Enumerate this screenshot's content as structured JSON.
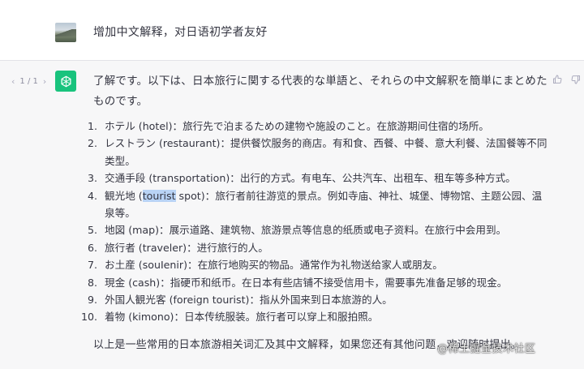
{
  "user_message": {
    "text": "增加中文解释，对日语初学者友好"
  },
  "assistant": {
    "pager": {
      "label": "1 / 1"
    },
    "intro": "了解です。以下は、日本旅行に関する代表的な単語と、それらの中文解釈を簡単にまとめたものです。",
    "items": [
      {
        "num": "1.",
        "text": "ホテル (hotel)：旅行先で泊まるための建物や施設のこと。在旅游期间住宿的场所。"
      },
      {
        "num": "2.",
        "text": "レストラン (restaurant)：提供餐饮服务的商店。有和食、西餐、中餐、意大利餐、法国餐等不同类型。"
      },
      {
        "num": "3.",
        "text": "交通手段 (transportation)：出行的方式。有电车、公共汽车、出租车、租车等多种方式。"
      },
      {
        "num": "4.",
        "pre": "観光地 (",
        "highlight": "tourist",
        "post": " spot)：旅行者前往游览的景点。例如寺庙、神社、城堡、博物馆、主题公园、温泉等。"
      },
      {
        "num": "5.",
        "text": "地図 (map)：展示道路、建筑物、旅游景点等信息的纸质或电子资料。在旅行中会用到。"
      },
      {
        "num": "6.",
        "text": "旅行者 (traveler)：进行旅行的人。"
      },
      {
        "num": "7.",
        "pre": "お土産 (sou",
        "caret": "I",
        "post": "enir)：在旅行地购买的物品。通常作为礼物送给家人或朋友。"
      },
      {
        "num": "8.",
        "text": "現金 (cash)：指硬币和纸币。在日本有些店铺不接受信用卡，需要事先准备足够的现金。"
      },
      {
        "num": "9.",
        "text": "外国人観光客 (foreign tourist)：指从外国来到日本旅游的人。"
      },
      {
        "num": "10.",
        "text": "着物 (kimono)：日本传统服装。旅行者可以穿上和服拍照。"
      }
    ],
    "summary": "以上是一些常用的日本旅游相关词汇及其中文解释，如果您还有其他问题，欢迎随时提出。"
  },
  "watermark": "@稀土掘金技术社区",
  "colors": {
    "assistant_avatar": "#19c37d",
    "assistant_bg": "#f7f7f8",
    "highlight": "#b9d3f5"
  },
  "icons": [
    "user-avatar",
    "chatgpt-logo-icon",
    "chevron-left-icon",
    "chevron-right-icon",
    "thumbs-up-icon",
    "thumbs-down-icon"
  ]
}
